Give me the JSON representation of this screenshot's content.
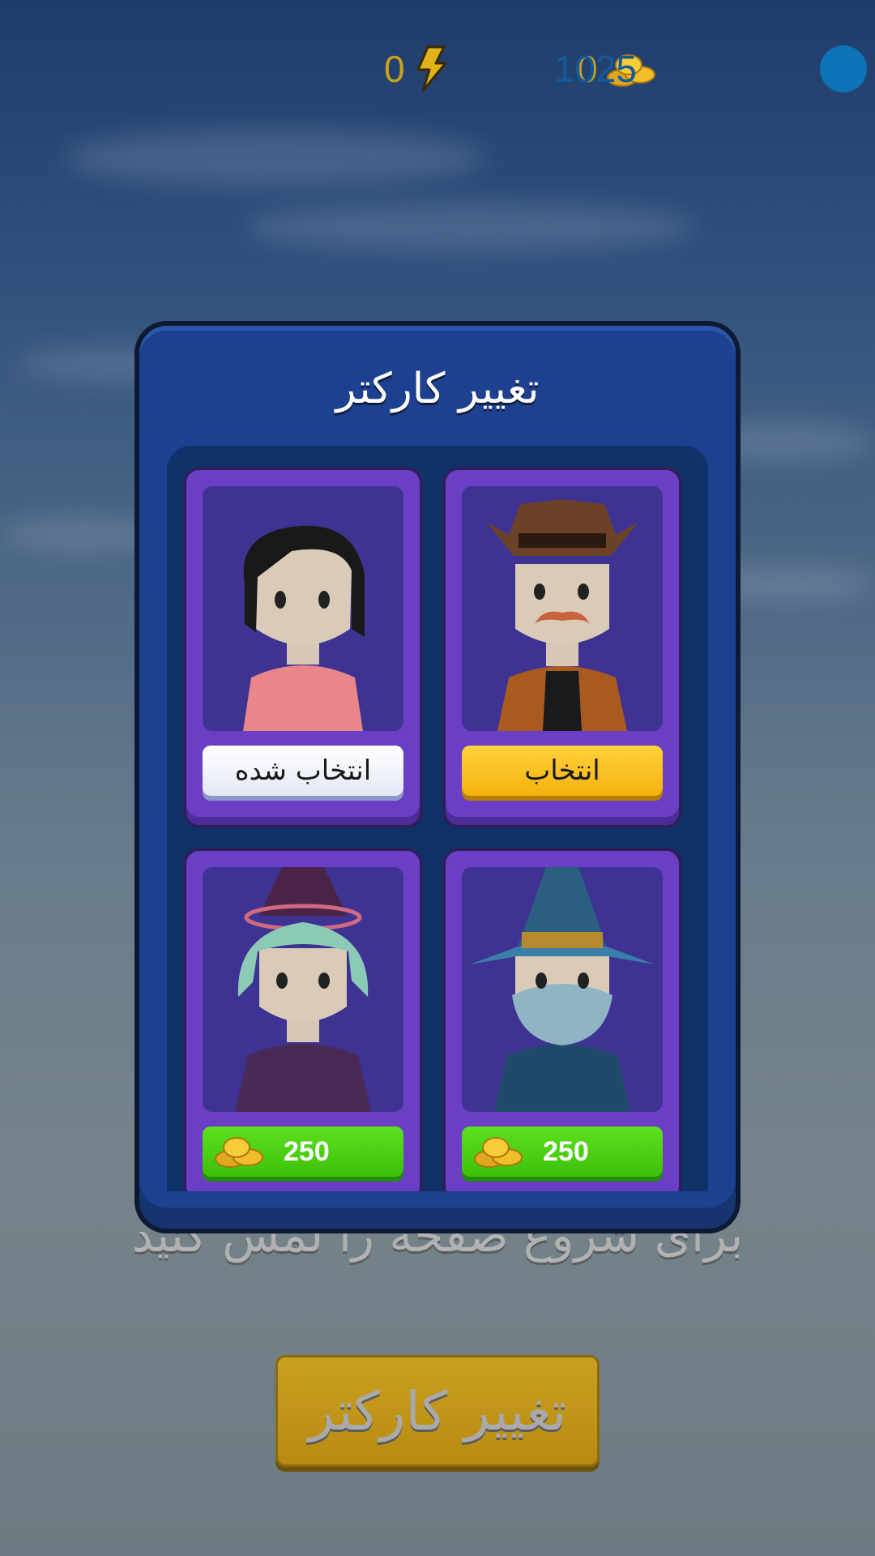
{
  "hud": {
    "energy": "0",
    "coins": "0",
    "gems": "1025"
  },
  "background": {
    "hint": "برای شروع صفحه را لمس کنید",
    "change_button": "تغییر کارکتر"
  },
  "modal": {
    "title": "تغییر کارکتر",
    "characters": [
      {
        "name": "girl-pink-shirt",
        "state": "selected",
        "button_label": "انتخاب شده"
      },
      {
        "name": "cowboy",
        "state": "select",
        "button_label": "انتخاب"
      },
      {
        "name": "witch",
        "state": "buy",
        "price": "250",
        "price_icon": "coins-icon"
      },
      {
        "name": "wizard",
        "state": "buy",
        "price": "250",
        "price_icon": "coins-icon"
      }
    ]
  },
  "colors": {
    "modal": "#1d4190",
    "card": "#6a3fc6",
    "select_button": "#f6b10e",
    "buy_button": "#3cc00a",
    "gem": "#0d74b8"
  }
}
